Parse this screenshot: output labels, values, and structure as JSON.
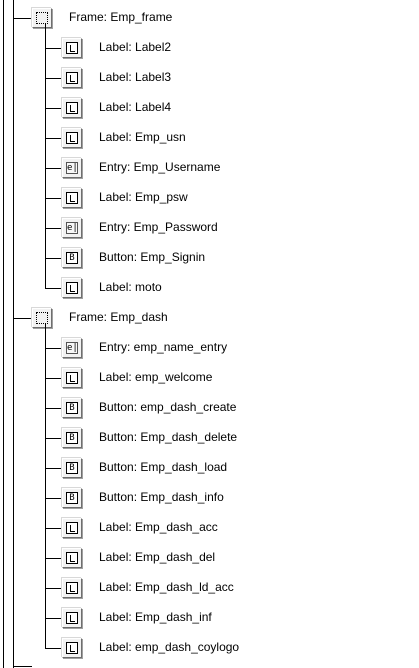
{
  "tree": {
    "frames": [
      {
        "label": "Frame: Emp_frame",
        "children": [
          {
            "type": "label",
            "text": "Label: Label2"
          },
          {
            "type": "label",
            "text": "Label: Label3"
          },
          {
            "type": "label",
            "text": "Label: Label4"
          },
          {
            "type": "label",
            "text": "Label: Emp_usn"
          },
          {
            "type": "entry",
            "text": "Entry: Emp_Username"
          },
          {
            "type": "label",
            "text": "Label: Emp_psw"
          },
          {
            "type": "entry",
            "text": "Entry: Emp_Password"
          },
          {
            "type": "button",
            "text": "Button: Emp_Signin"
          },
          {
            "type": "label",
            "text": "Label: moto"
          }
        ]
      },
      {
        "label": "Frame: Emp_dash",
        "children": [
          {
            "type": "entry",
            "text": "Entry: emp_name_entry"
          },
          {
            "type": "label",
            "text": "Label: emp_welcome"
          },
          {
            "type": "button",
            "text": "Button: emp_dash_create"
          },
          {
            "type": "button",
            "text": "Button: Emp_dash_delete"
          },
          {
            "type": "button",
            "text": "Button: Emp_dash_load"
          },
          {
            "type": "button",
            "text": "Button: Emp_dash_info"
          },
          {
            "type": "label",
            "text": "Label: Emp_dash_acc"
          },
          {
            "type": "label",
            "text": "Label: Emp_dash_del"
          },
          {
            "type": "label",
            "text": "Label: Emp_dash_ld_acc"
          },
          {
            "type": "label",
            "text": "Label: Emp_dash_inf"
          },
          {
            "type": "label",
            "text": "Label: emp_dash_coylogo"
          }
        ]
      }
    ],
    "icon_glyphs": {
      "entry": "e|",
      "button": "B"
    }
  }
}
